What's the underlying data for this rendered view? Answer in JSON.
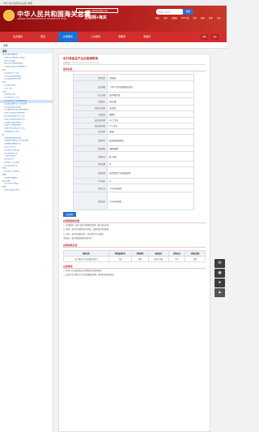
{
  "topbar": {
    "text": "中华人民共和国海关总署 | 繁體"
  },
  "header": {
    "logo_cn": "中华人民共和国海关总署",
    "logo_en": "GENERAL ADMINISTRATION OF CUSTOMS P.R.CHINA",
    "ihub_badge": "全国一体化政务服务平台",
    "ihub_title": "互联网+海关",
    "search_placeholder": "请输入关键字",
    "search_button": "搜索",
    "quick_links": [
      "登录",
      "注册",
      "无障碍",
      "APP下载",
      "首页",
      "服务",
      "办事",
      "互动"
    ]
  },
  "nav": {
    "items": [
      "业务服务",
      "首页",
      "办事服务",
      "公共服务",
      "我要查",
      "我要问"
    ],
    "active_index": 2,
    "mini": [
      "搜索",
      "更多"
    ]
  },
  "breadcrumb": "办理",
  "sidebar": {
    "header": "事项",
    "items": [
      {
        "label": "海关行政审批事项",
        "level": 1
      },
      {
        "label": "进出口货物收发货人备案",
        "level": 2
      },
      {
        "label": "报关企业备案",
        "level": 2
      },
      {
        "label": "报关企业分支机构备案",
        "level": 2
      },
      {
        "label": "从事海关监管货物运输企业",
        "level": 2
      },
      {
        "label": "出口",
        "level": 1
      },
      {
        "label": "出口食品生产企业",
        "level": 2
      },
      {
        "label": "出口食品原料种植场",
        "level": 2
      },
      {
        "label": "出口食品原料养殖场",
        "level": 2
      },
      {
        "label": "出口",
        "level": 1
      },
      {
        "label": "出口商品检验",
        "level": 2
      },
      {
        "label": "出口飞机",
        "level": 2
      },
      {
        "label": "企业",
        "level": 1
      },
      {
        "label": "海关认证企业",
        "level": 2
      },
      {
        "label": "出口食品生产企业",
        "level": 2
      },
      {
        "label": "出口食品生产企业备案核准",
        "level": 2,
        "selected": true
      },
      {
        "label": "进口食品境外生产企业注册",
        "level": 2
      },
      {
        "label": "进口食品进口商备案",
        "level": 2
      },
      {
        "label": "出口植物源性食品原料种植场",
        "level": 2
      },
      {
        "label": "进出口商品检验鉴定机构",
        "level": 2
      },
      {
        "label": "进口化妆品境外生产企业",
        "level": 2
      },
      {
        "label": "进出口商品检验鉴定业务",
        "level": 2
      },
      {
        "label": "供港澳活畜禽饲养场",
        "level": 2
      },
      {
        "label": "出境水生动物养殖场",
        "level": 2
      },
      {
        "label": "出境竹木草制品生产企业",
        "level": 2
      },
      {
        "label": "进境粮食加工企业",
        "level": 2
      },
      {
        "label": "检",
        "level": 1
      },
      {
        "label": "进境动植物检疫审批",
        "level": 2
      },
      {
        "label": "进出境特殊物品卫生检疫审批",
        "level": 2
      },
      {
        "label": "出境植物及植物产品",
        "level": 2
      },
      {
        "label": "口岸卫生许可",
        "level": 2
      },
      {
        "label": "出口危险货物包装",
        "level": 2
      },
      {
        "label": "进口旧机电产品",
        "level": 2
      },
      {
        "label": "入境特殊物品",
        "level": 2
      },
      {
        "label": "出入境人员",
        "level": 2
      },
      {
        "label": "国际旅行卫生保健",
        "level": 2
      },
      {
        "label": "出入境交通工具",
        "level": 2
      },
      {
        "label": "其他",
        "level": 1
      },
      {
        "label": "海关知识产权备案",
        "level": 2
      },
      {
        "label": "税费",
        "level": 1
      },
      {
        "label": "减免税审核确认",
        "level": 2
      },
      {
        "label": "加工贸易",
        "level": 1
      },
      {
        "label": "加工贸易手册设立",
        "level": 2
      },
      {
        "label": "保税",
        "level": 1
      },
      {
        "label": "保税仓库设立审批",
        "level": 2
      }
    ]
  },
  "main": {
    "title": "出口食品生产企业备案核准",
    "subtitle": "实施编码：11100000000018193Y4000117002",
    "sec_basic": "基本信息",
    "info_rows": [
      {
        "k": "事项类型",
        "v": "行政确认"
      },
      {
        "k": "设定依据",
        "v": "《中华人民共和国食品安全法》"
      },
      {
        "k": "权力来源",
        "v": "法定本级行使"
      },
      {
        "k": "实施机关",
        "v": "海关总署"
      },
      {
        "k": "实施主体性质",
        "v": "法定机关"
      },
      {
        "k": "行使层级",
        "v": "国家级"
      },
      {
        "k": "法定办结时限",
        "v": "20个工作日"
      },
      {
        "k": "承诺办结时限",
        "v": "5个工作日"
      },
      {
        "k": "办件类型",
        "v": "承诺件"
      },
      {
        "k": "受理条件",
        "v": "依法取得营业执照"
      },
      {
        "k": "数量限制",
        "v": "无数量限制"
      },
      {
        "k": "办理形式",
        "v": "网上办理"
      },
      {
        "k": "是否收费",
        "v": "否"
      },
      {
        "k": "结果名称",
        "v": "出口食品生产企业备案证明"
      },
      {
        "k": "中介服务",
        "v": "无"
      },
      {
        "k": "咨询方式",
        "v": "12360海关热线"
      },
      {
        "k": "监督投诉",
        "v": "12360海关热线"
      }
    ],
    "tab_label": "办理流程",
    "sec_conditions": "办理流程和时限",
    "conditions": [
      "(一)申请受理。申请人通过中国国际贸易单一窗口提出申请。",
      "(二)审核。海关对申请材料进行审核，必要时进行现场核查。",
      "(三)决定。海关作出备案决定，符合条件的予以备案。",
      "(四)送达。海关将备案结果告知申请人。"
    ],
    "sec_materials": "办理材料目录",
    "materials_headers": [
      "材料名称",
      "材料填报样本",
      "材料类型",
      "来源渠道",
      "材料形式",
      "材料必要性"
    ],
    "materials_rows": [
      [
        "出口食品生产企业备案申请书",
        "下载",
        "原件",
        "申请人自备",
        "电子",
        "必要"
      ]
    ],
    "sec_notes": "注意事项",
    "notes": [
      "(一)申请人应当如实提交有关材料和反映真实情况。",
      "(二)海关对出口食品生产企业实施备案管理，具体要求见相关规定。"
    ]
  },
  "side_tools": [
    "share",
    "wechat",
    "weibo",
    "back-to-top"
  ]
}
